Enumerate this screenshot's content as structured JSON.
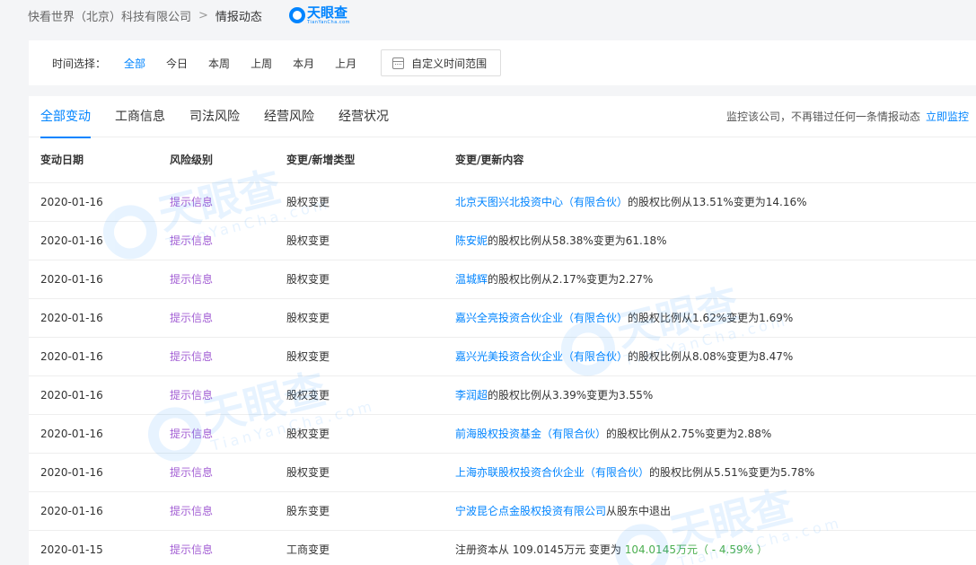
{
  "breadcrumb": {
    "company": "快看世界（北京）科技有限公司",
    "separator": ">",
    "current": "情报动态"
  },
  "logo": {
    "text": "天眼查",
    "sub": "TianYanCha.com"
  },
  "filter": {
    "label": "时间选择：",
    "options": [
      "全部",
      "今日",
      "本周",
      "上周",
      "本月",
      "上月"
    ],
    "active": "全部",
    "custom_range": "自定义时间范围"
  },
  "tabs": [
    "全部变动",
    "工商信息",
    "司法风险",
    "经营风险",
    "经营状况"
  ],
  "monitor": {
    "text": "监控该公司，不再错过任何一条情报动态",
    "link": "立即监控"
  },
  "table": {
    "headers": [
      "变动日期",
      "风险级别",
      "变更/新增类型",
      "变更/更新内容"
    ],
    "rows": [
      {
        "date": "2020-01-16",
        "risk": "提示信息",
        "type": "股权变更",
        "entity": "北京天图兴北投资中心（有限合伙）",
        "detail": "的股权比例从13.51%变更为14.16%"
      },
      {
        "date": "2020-01-16",
        "risk": "提示信息",
        "type": "股权变更",
        "entity": "陈安妮",
        "detail": "的股权比例从58.38%变更为61.18%"
      },
      {
        "date": "2020-01-16",
        "risk": "提示信息",
        "type": "股权变更",
        "entity": "温城辉",
        "detail": "的股权比例从2.17%变更为2.27%"
      },
      {
        "date": "2020-01-16",
        "risk": "提示信息",
        "type": "股权变更",
        "entity": "嘉兴全亮投资合伙企业（有限合伙）",
        "detail": "的股权比例从1.62%变更为1.69%"
      },
      {
        "date": "2020-01-16",
        "risk": "提示信息",
        "type": "股权变更",
        "entity": "嘉兴光美投资合伙企业（有限合伙）",
        "detail": "的股权比例从8.08%变更为8.47%"
      },
      {
        "date": "2020-01-16",
        "risk": "提示信息",
        "type": "股权变更",
        "entity": "李润超",
        "detail": "的股权比例从3.39%变更为3.55%"
      },
      {
        "date": "2020-01-16",
        "risk": "提示信息",
        "type": "股权变更",
        "entity": "前海股权投资基金（有限合伙）",
        "detail": "的股权比例从2.75%变更为2.88%"
      },
      {
        "date": "2020-01-16",
        "risk": "提示信息",
        "type": "股权变更",
        "entity": "上海亦联股权投资合伙企业（有限合伙）",
        "detail": "的股权比例从5.51%变更为5.78%"
      },
      {
        "date": "2020-01-16",
        "risk": "提示信息",
        "type": "股东变更",
        "entity": "宁波昆仑点金股权投资有限公司",
        "detail": "从股东中退出"
      },
      {
        "date": "2020-01-15",
        "risk": "提示信息",
        "type": "工商变更",
        "entity": "",
        "detail": "注册资本从 109.0145万元 变更为 ",
        "green": "104.0145万元（ - 4.59% ）"
      }
    ]
  },
  "colors": {
    "accent": "#0084ff",
    "risk": "#a35fd4",
    "green": "#4caf50"
  }
}
